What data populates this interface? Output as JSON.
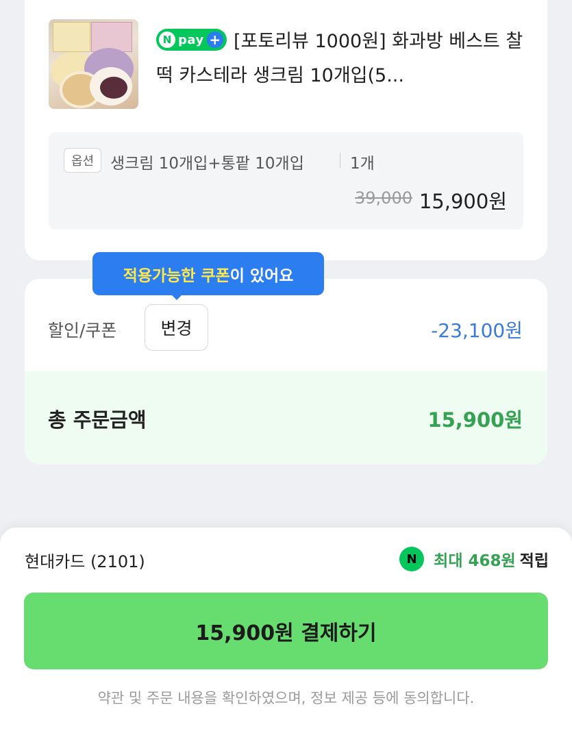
{
  "product": {
    "image_icon": "product-photo",
    "badge_n": "N",
    "badge_text": "pay",
    "badge_plus": "+",
    "title": "[포토리뷰 1000원] 화과방 베스트 찰떡 카스테라 생크림 10개입(5..."
  },
  "option": {
    "tag": "옵션",
    "name": "생크림 10개입+통팥 10개입",
    "quantity": "1개",
    "original_price": "39,000",
    "price": "15,900원"
  },
  "coupon": {
    "tooltip_highlight": "적용가능한 쿠폰",
    "tooltip_rest": "이 있어요",
    "discount_label": "할인/쿠폰",
    "change_button": "변경",
    "discount_amount": "-23,100원"
  },
  "total": {
    "label": "총 주문금액",
    "amount": "15,900원"
  },
  "payment": {
    "card_name": "현대카드 (2101)",
    "reward_icon": "N",
    "reward_amount": "최대 468원",
    "reward_suffix": "적립",
    "pay_button": "15,900원 결제하기",
    "agreement": "약관 및 주문 내용을 확인하였으며, 정보 제공 등에 동의합니다."
  },
  "colors": {
    "accent_green": "#67dc6f",
    "npay_green": "#03c75a",
    "discount_blue": "#3a7ad8",
    "tooltip_blue": "#2c7df0"
  }
}
